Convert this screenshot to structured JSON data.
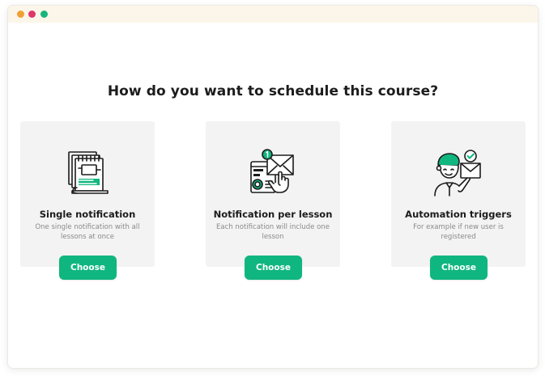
{
  "window": {
    "traffic_lights": [
      "#f0a136",
      "#e0366a",
      "#16b57e"
    ]
  },
  "heading": "How do you want to schedule this course?",
  "accent_color": "#10b67f",
  "cards": [
    {
      "icon": "calendar-documents-icon",
      "title": "Single notification",
      "description": "One single notification with all lessons at once",
      "button": "Choose"
    },
    {
      "icon": "email-notification-icon",
      "title": "Notification per lesson",
      "description": "Each notification will include one lesson",
      "button": "Choose"
    },
    {
      "icon": "person-email-icon",
      "title": "Automation triggers",
      "description": "For example if new user is registered",
      "button": "Choose"
    }
  ]
}
